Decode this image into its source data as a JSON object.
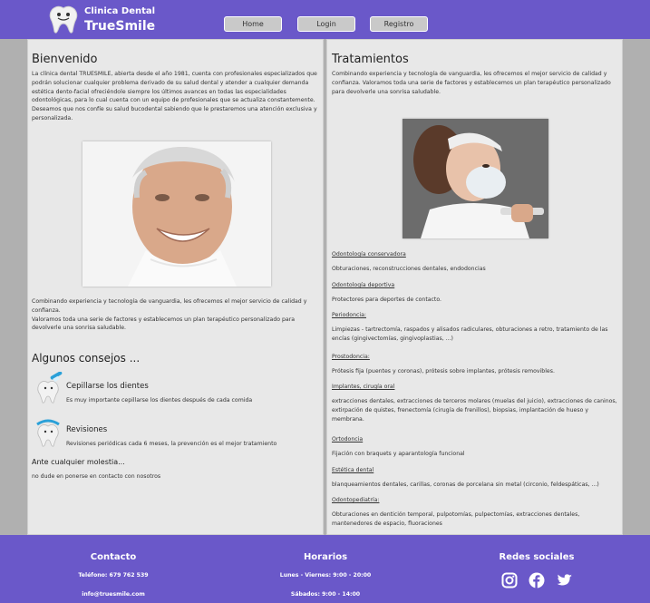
{
  "header": {
    "brand_small": "Clinica Dental",
    "brand_big": "TrueSmile",
    "nav": {
      "home": "Home",
      "login": "Login",
      "registro": "Registro"
    }
  },
  "left": {
    "title": "Bienvenido",
    "intro": "La clínica dental TRUESMILE, abierta desde el año 1981, cuenta con profesionales especializados que podrán solucionar cualquier problema derivado de su salud dental y atender a cualquier demanda estética dento-facial ofreciéndole siempre los últimos avances en todas las especialidades odontológicas, para lo cual cuenta con un equipo de profesionales que se actualiza constantemente. Deseamos que nos confíe su salud bucodental sabiendo que le prestaremos una atención exclusiva y personalizada.",
    "para2": "Combinando experiencia y tecnología de vanguardia, les ofrecemos el mejor servicio de calidad y confianza.\nValoramos toda una serie de factores y establecemos un plan terapéutico personalizado para devolverle una sonrisa saludable.",
    "consejos_title": "Algunos consejos ...",
    "tip1_title": "Cepillarse los dientes",
    "tip1_text": "Es muy importante cepillarse los dientes después de cada comida",
    "tip2_title": "Revisiones",
    "tip2_text": "Revisiones periódicas cada 6 meses, la prevención es el mejor tratamiento",
    "molestia_title": "Ante cualquier molestia...",
    "molestia_text": "no dude en ponerse en contacto con nosotros"
  },
  "right": {
    "title": "Tratamientos",
    "intro": "Combinando experiencia y tecnología de vanguardia, les ofrecemos el mejor servicio de calidad y confianza. Valoramos toda una serie de factores y establecemos un plan terapéutico personalizado para devolverle una sonrisa saludable.",
    "treatments": [
      {
        "title": "Odontología conservadora",
        "desc": "Obturaciones, reconstrucciones dentales, endodoncias"
      },
      {
        "title": "Odontología deportiva",
        "desc": "Protectores para deportes de contacto."
      },
      {
        "title": "Periodoncia:",
        "desc": "Limpiezas - tartrectomía, raspados y alisados radiculares, obturaciones a retro, tratamiento de las encías (gingivectomías, gingivoplastias, ...)"
      },
      {
        "title": "Prostodoncia:",
        "desc": "Prótesis fija (puentes y coronas), prótesis sobre implantes, prótesis removibles."
      },
      {
        "title": "Implantes, cirugía oral",
        "desc": "extracciones dentales, extracciones de terceros molares (muelas del juicio), extracciones de caninos, extirpación de quistes, frenectomía (cirugía de frenillos), biopsias, implantación de hueso y membrana."
      },
      {
        "title": "Ortodoncia",
        "desc": "Fijación con braquets y aparantología funcional"
      },
      {
        "title": "Estética dental",
        "desc": "blanqueamientos dentales, carillas, coronas de porcelana sin metal (circonio, feldespáticas, ...)"
      },
      {
        "title": "Odontopediatría:",
        "desc": "Obturaciones en dentición temporal, pulpotomías, pulpectomías, extracciones dentales, mantenedores de espacio, fluoraciones"
      }
    ]
  },
  "footer": {
    "contacto_title": "Contacto",
    "telefono": "Teléfono: 679 762 539",
    "email": "info@truesmile.com",
    "horarios_title": "Horarios",
    "horario1": "Lunes - Viernes: 9:00 - 20:00",
    "horario2": "Sábados: 9:00 - 14:00",
    "redes_title": "Redes sociales",
    "social_icons": [
      "instagram-icon",
      "facebook-icon",
      "twitter-icon"
    ]
  },
  "colors": {
    "brand": "#6a58c9",
    "panel": "#e8e8e8",
    "side": "#b0b0b0"
  }
}
